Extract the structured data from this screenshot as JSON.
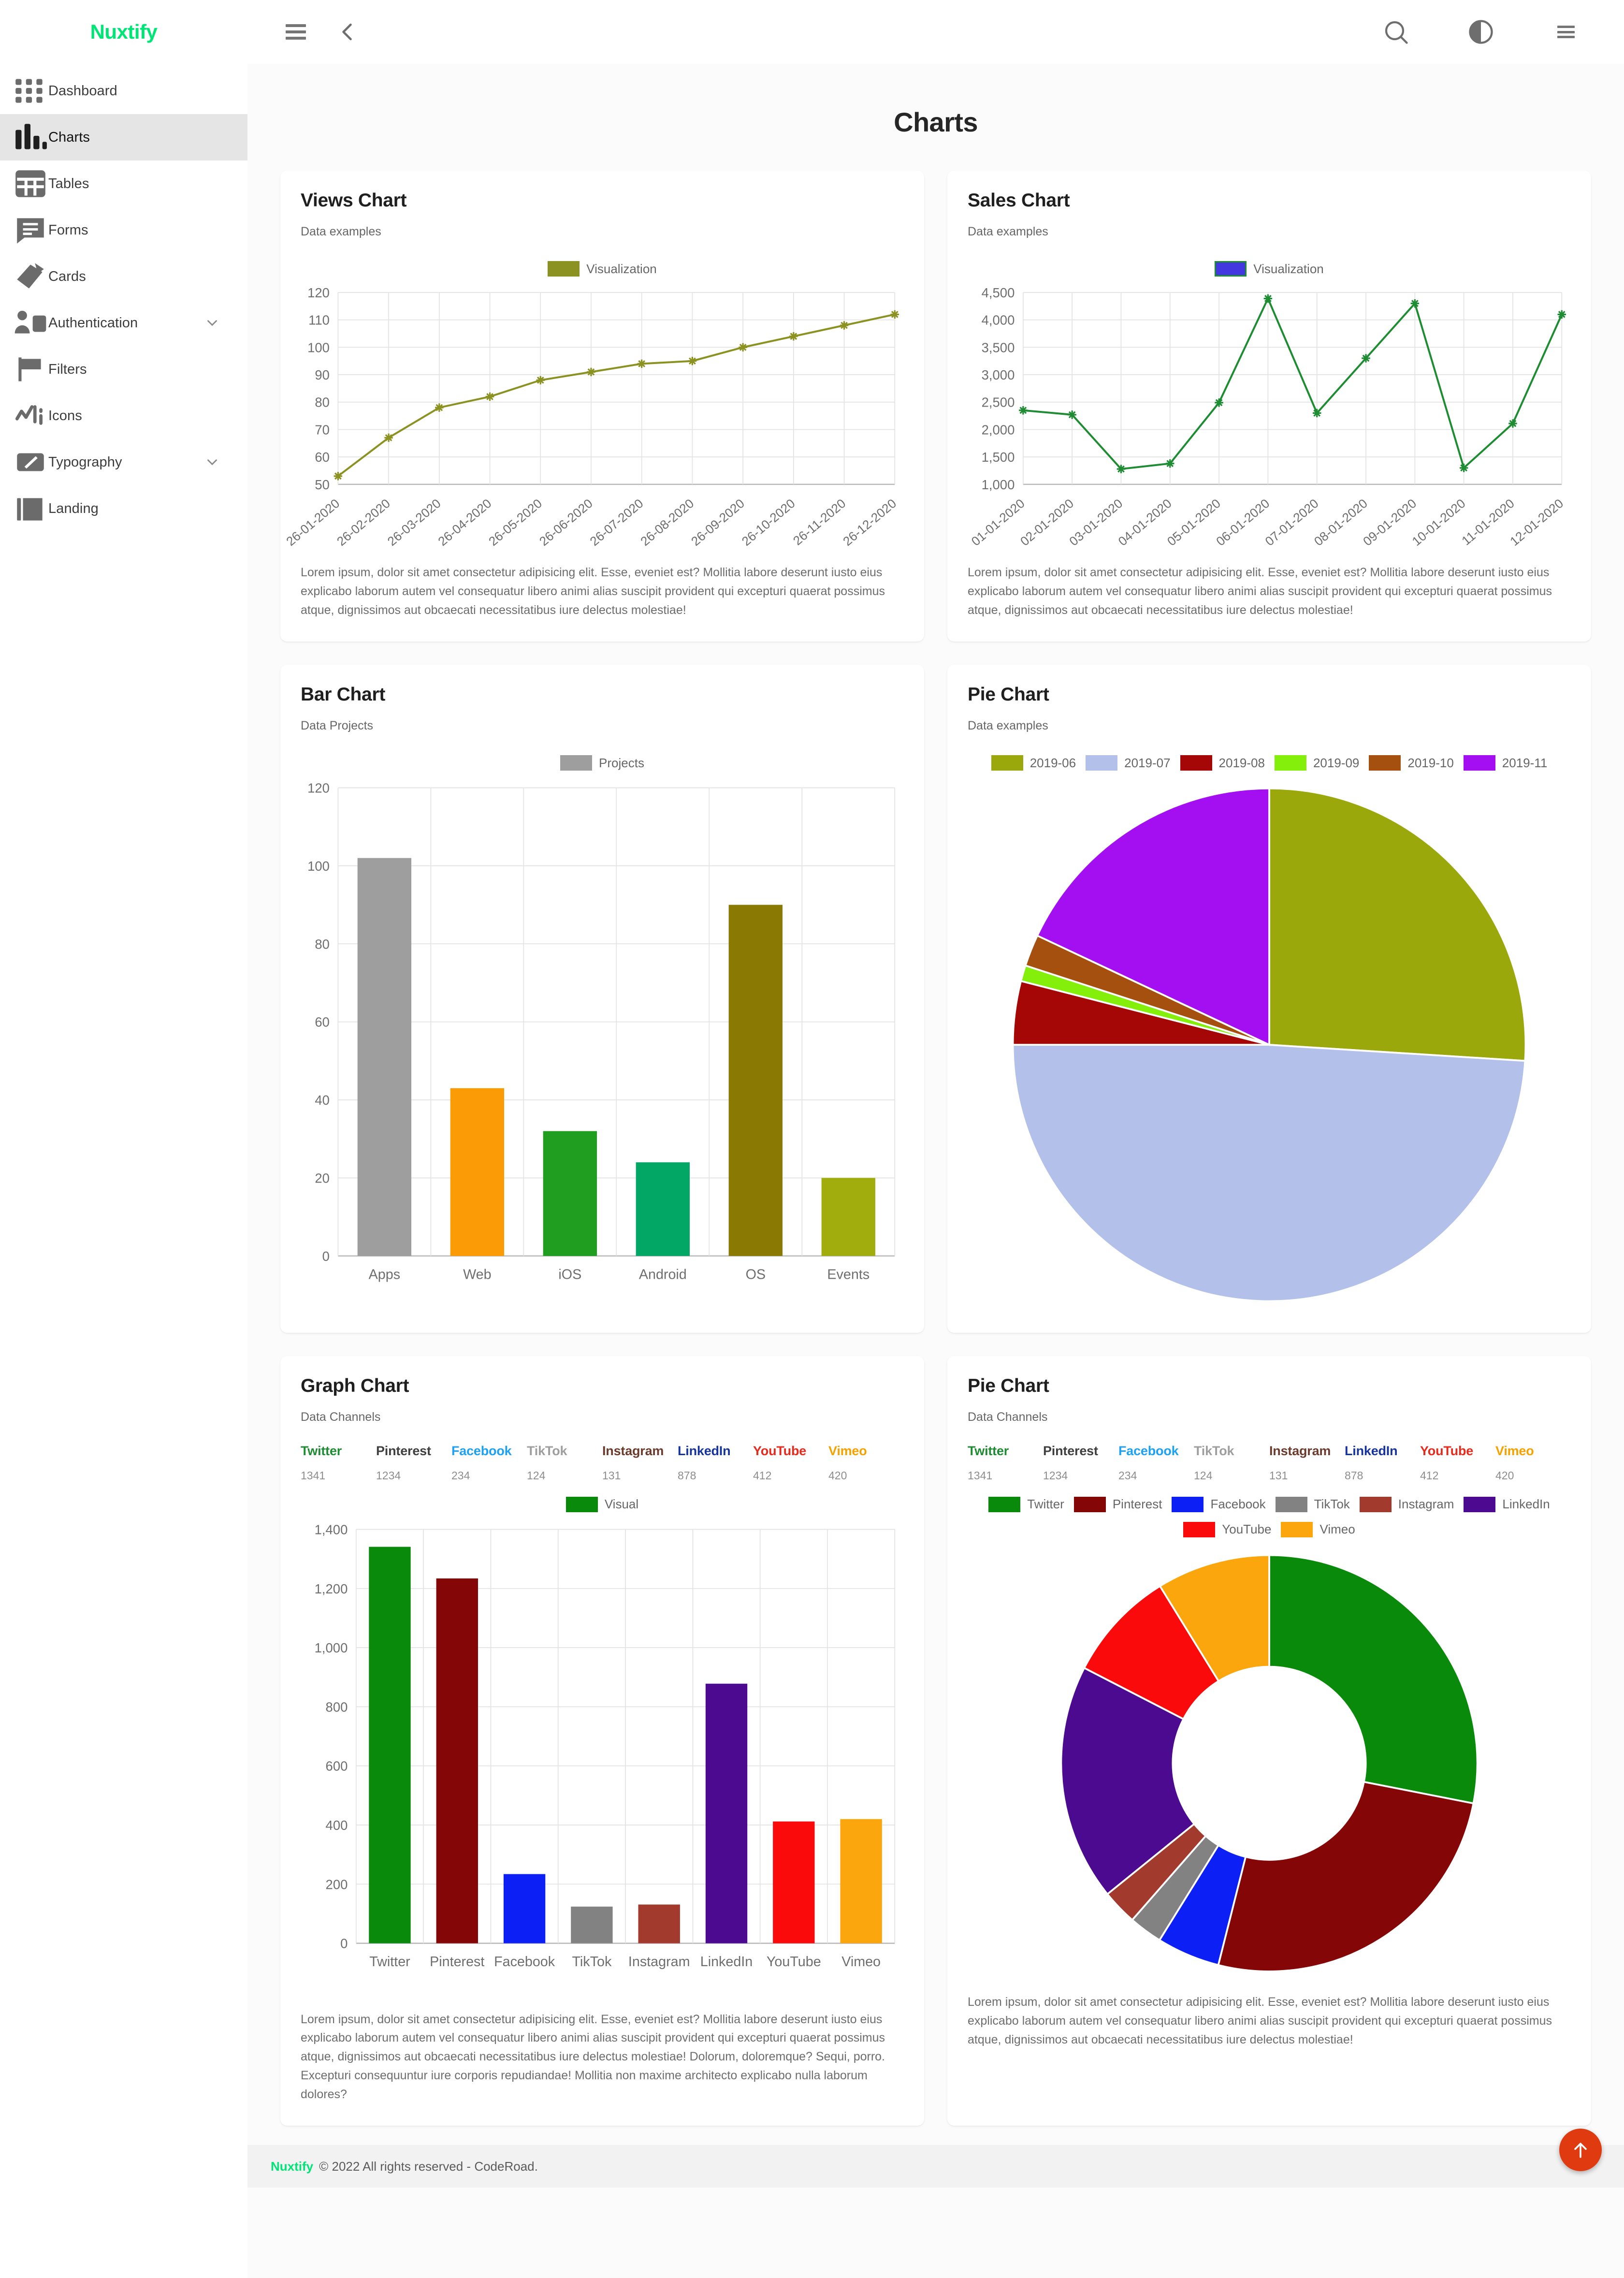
{
  "brand": "Nuxtify",
  "header": {
    "menu_icon": "hamburger-icon",
    "back_icon": "chevron-left-icon",
    "search_icon": "search-icon",
    "theme_icon": "theme-contrast-icon",
    "more_icon": "menu-icon"
  },
  "sidebar": {
    "items": [
      {
        "label": "Dashboard",
        "icon": "grid-icon",
        "active": false,
        "expandable": false
      },
      {
        "label": "Charts",
        "icon": "bar-chart-icon",
        "active": true,
        "expandable": false
      },
      {
        "label": "Tables",
        "icon": "table-icon",
        "active": false,
        "expandable": false
      },
      {
        "label": "Forms",
        "icon": "form-icon",
        "active": false,
        "expandable": false
      },
      {
        "label": "Cards",
        "icon": "cards-icon",
        "active": false,
        "expandable": false
      },
      {
        "label": "Authentication",
        "icon": "user-icon",
        "active": false,
        "expandable": true
      },
      {
        "label": "Filters",
        "icon": "flag-icon",
        "active": false,
        "expandable": false
      },
      {
        "label": "Icons",
        "icon": "icons-icon",
        "active": false,
        "expandable": false
      },
      {
        "label": "Typography",
        "icon": "pencil-icon",
        "active": false,
        "expandable": true
      },
      {
        "label": "Landing",
        "icon": "landing-icon",
        "active": false,
        "expandable": false
      }
    ]
  },
  "page": {
    "title": "Charts"
  },
  "lorem_short": "Lorem ipsum, dolor sit amet consectetur adipisicing elit. Esse, eveniet est? Mollitia labore deserunt iusto eius explicabo laborum autem vel consequatur libero animi alias suscipit provident qui excepturi quaerat possimus atque, dignissimos aut obcaecati necessitatibus iure delectus molestiae!",
  "lorem_long": "Lorem ipsum, dolor sit amet consectetur adipisicing elit. Esse, eveniet est? Mollitia labore deserunt iusto eius explicabo laborum autem vel consequatur libero animi alias suscipit provident qui excepturi quaerat possimus atque, dignissimos aut obcaecati necessitatibus iure delectus molestiae! Dolorum, doloremque? Sequi, porro. Excepturi consequuntur iure corporis repudiandae! Mollitia non maxime architecto explicabo nulla laborum dolores?",
  "cards": {
    "views": {
      "title": "Views Chart",
      "subtitle": "Data examples"
    },
    "sales": {
      "title": "Sales Chart",
      "subtitle": "Data examples"
    },
    "bar": {
      "title": "Bar Chart",
      "subtitle": "Data Projects"
    },
    "pie": {
      "title": "Pie Chart",
      "subtitle": "Data examples"
    },
    "graph": {
      "title": "Graph Chart",
      "subtitle": "Data Channels"
    },
    "donut": {
      "title": "Pie Chart",
      "subtitle": "Data Channels"
    }
  },
  "channels": {
    "names": [
      "Twitter",
      "Pinterest",
      "Facebook",
      "TikTok",
      "Instagram",
      "LinkedIn",
      "YouTube",
      "Vimeo"
    ],
    "values": [
      "1341",
      "1234",
      "234",
      "124",
      "131",
      "878",
      "412",
      "420"
    ],
    "name_colors": [
      "#1e8c32",
      "#3f3f3f",
      "#1da1f2",
      "#9e9e9e",
      "#6b3b2e",
      "#17349c",
      "#e8291c",
      "#f5a201"
    ]
  },
  "footer": {
    "brand": "Nuxtify",
    "text": "© 2022 All rights reserved - CodeRoad."
  },
  "fab": {
    "icon": "arrow-up-icon",
    "color": "#e03b10"
  },
  "chart_data": [
    {
      "id": "views",
      "type": "line",
      "title": "Views Chart",
      "subtitle": "Data examples",
      "legend": [
        {
          "name": "Visualization",
          "color": "#8b9221"
        }
      ],
      "legend_position": "top",
      "grid": true,
      "color": "#8b9221",
      "x": [
        "26-01-2020",
        "26-02-2020",
        "26-03-2020",
        "26-04-2020",
        "26-05-2020",
        "26-06-2020",
        "26-07-2020",
        "26-08-2020",
        "26-09-2020",
        "26-10-2020",
        "26-11-2020",
        "26-12-2020"
      ],
      "values": [
        53,
        67,
        78,
        82,
        88,
        91,
        94,
        95,
        100,
        104,
        108,
        112
      ],
      "yticks": [
        50,
        60,
        70,
        80,
        90,
        100,
        110,
        120
      ],
      "ylim": [
        50,
        120
      ],
      "xlabel": "",
      "ylabel": ""
    },
    {
      "id": "sales",
      "type": "line",
      "title": "Sales Chart",
      "subtitle": "Data examples",
      "legend": [
        {
          "name": "Visualization",
          "color": "#4338e0"
        }
      ],
      "legend_position": "top",
      "grid": true,
      "color": "#1e8c32",
      "x": [
        "01-01-2020",
        "02-01-2020",
        "03-01-2020",
        "04-01-2020",
        "05-01-2020",
        "06-01-2020",
        "07-01-2020",
        "08-01-2020",
        "09-01-2020",
        "10-01-2020",
        "11-01-2020",
        "12-01-2020"
      ],
      "values": [
        2350,
        2270,
        1280,
        1380,
        2490,
        4390,
        2300,
        3300,
        4300,
        1300,
        2110,
        4100
      ],
      "yticks": [
        1000,
        1500,
        2000,
        2500,
        3000,
        3500,
        4000,
        4500
      ],
      "ytick_labels": [
        "1,000",
        "1,500",
        "2,000",
        "2,500",
        "3,000",
        "3,500",
        "4,000",
        "4,500"
      ],
      "ylim": [
        1000,
        4500
      ],
      "xlabel": "",
      "ylabel": ""
    },
    {
      "id": "bar",
      "type": "bar",
      "title": "Bar Chart",
      "subtitle": "Data Projects",
      "legend": [
        {
          "name": "Projects",
          "color": "#9e9e9e"
        }
      ],
      "legend_position": "top",
      "grid": true,
      "categories": [
        "Apps",
        "Web",
        "iOS",
        "Android",
        "OS",
        "Events"
      ],
      "values": [
        102,
        43,
        32,
        24,
        90,
        20
      ],
      "colors": [
        "#9e9e9e",
        "#fb9b06",
        "#1f9e1f",
        "#03a765",
        "#8a7a04",
        "#a0ad0d"
      ],
      "yticks": [
        0,
        20,
        40,
        60,
        80,
        100,
        120
      ],
      "ylim": [
        0,
        120
      ],
      "xlabel": "",
      "ylabel": ""
    },
    {
      "id": "pie",
      "type": "pie",
      "title": "Pie Chart",
      "subtitle": "Data examples",
      "legend_position": "top",
      "categories": [
        "2019-06",
        "2019-07",
        "2019-08",
        "2019-09",
        "2019-10",
        "2019-11"
      ],
      "values": [
        26,
        49,
        4,
        1,
        2,
        18
      ],
      "colors": [
        "#9aa80b",
        "#b3c1ea",
        "#a50606",
        "#83ef0b",
        "#a5500f",
        "#a40ff2"
      ]
    },
    {
      "id": "graph",
      "type": "bar",
      "title": "Graph Chart",
      "subtitle": "Data Channels",
      "legend": [
        {
          "name": "Visual",
          "color": "#0a8a0a"
        }
      ],
      "legend_position": "top",
      "grid": true,
      "categories": [
        "Twitter",
        "Pinterest",
        "Facebook",
        "TikTok",
        "Instagram",
        "LinkedIn",
        "YouTube",
        "Vimeo"
      ],
      "values": [
        1341,
        1234,
        234,
        124,
        131,
        878,
        412,
        420
      ],
      "colors": [
        "#0a8a0a",
        "#840606",
        "#0c1ff5",
        "#828282",
        "#a33a2e",
        "#4b0a8f",
        "#fa0a0a",
        "#fba60c"
      ],
      "yticks": [
        0,
        200,
        400,
        600,
        800,
        1000,
        1200,
        1400
      ],
      "ytick_labels": [
        "0",
        "200",
        "400",
        "600",
        "800",
        "1,000",
        "1,200",
        "1,400"
      ],
      "ylim": [
        0,
        1400
      ],
      "xlabel": "",
      "ylabel": ""
    },
    {
      "id": "donut",
      "type": "pie",
      "title": "Pie Chart",
      "subtitle": "Data Channels",
      "legend_position": "top",
      "donut": true,
      "categories": [
        "Twitter",
        "Pinterest",
        "Facebook",
        "TikTok",
        "Instagram",
        "LinkedIn",
        "YouTube",
        "Vimeo"
      ],
      "values": [
        1341,
        1234,
        234,
        124,
        131,
        878,
        412,
        420
      ],
      "colors": [
        "#0a8a0a",
        "#840606",
        "#0c1ff5",
        "#828282",
        "#a33a2e",
        "#4b0a8f",
        "#fa0a0a",
        "#fba60c"
      ]
    }
  ]
}
